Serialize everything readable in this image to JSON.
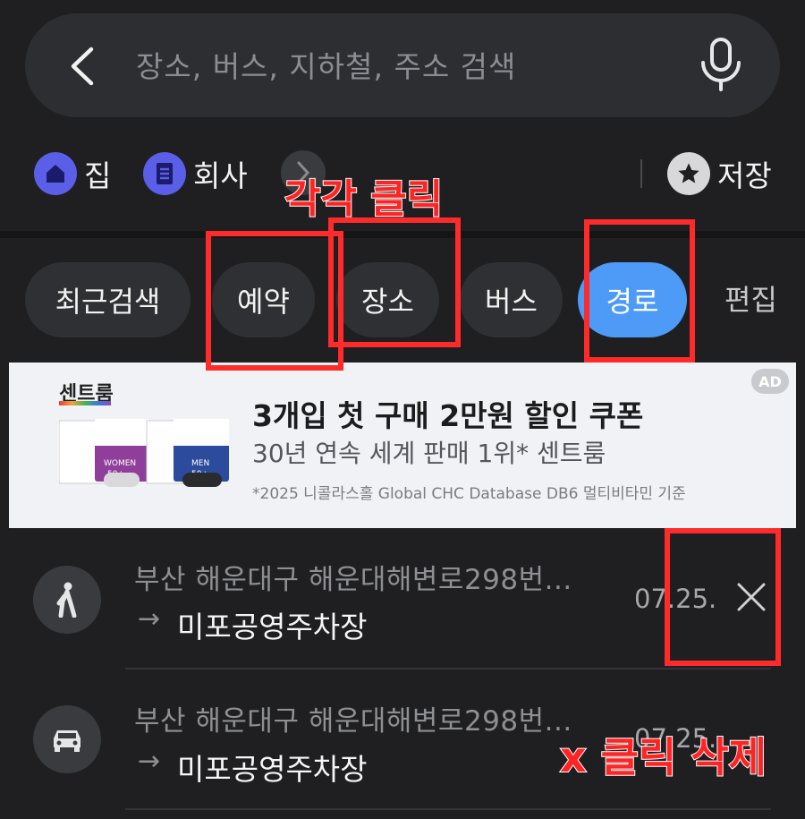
{
  "search": {
    "placeholder": "장소, 버스, 지하철, 주소 검색"
  },
  "quick": {
    "home_label": "집",
    "work_label": "회사",
    "saved_label": "저장"
  },
  "chips": [
    {
      "label": "최근검색",
      "active": false
    },
    {
      "label": "예약",
      "active": false
    },
    {
      "label": "장소",
      "active": false
    },
    {
      "label": "버스",
      "active": false
    },
    {
      "label": "경로",
      "active": true
    }
  ],
  "edit_label": "편집",
  "ad": {
    "badge": "AD",
    "brand": "센트룸",
    "title": "3개입 첫 구매 2만원 할인 쿠폰",
    "subtitle": "30년 연속 세계 판매 1위* 센트룸",
    "note": "*2025 니콜라스홀 Global CHC Database DB6 멀티비타민 기준"
  },
  "history": [
    {
      "mode": "walk-icon",
      "from": "부산 해운대구 해운대해변로298번...",
      "to": "미포공영주차장",
      "date": "07.25."
    },
    {
      "mode": "car-icon",
      "from": "부산 해운대구 해운대해변로298번...",
      "to": "미포공영주차장",
      "date": "07.25."
    }
  ],
  "annotations": {
    "click_each": "각각 클릭",
    "click_x_delete": "x 클릭 삭제"
  },
  "colors": {
    "background": "#1f1f21",
    "chip": "#2f3033",
    "chip_active": "#4d9bf7",
    "quick_icon": "#5b5fe8",
    "annotation": "#ff2a2a"
  }
}
